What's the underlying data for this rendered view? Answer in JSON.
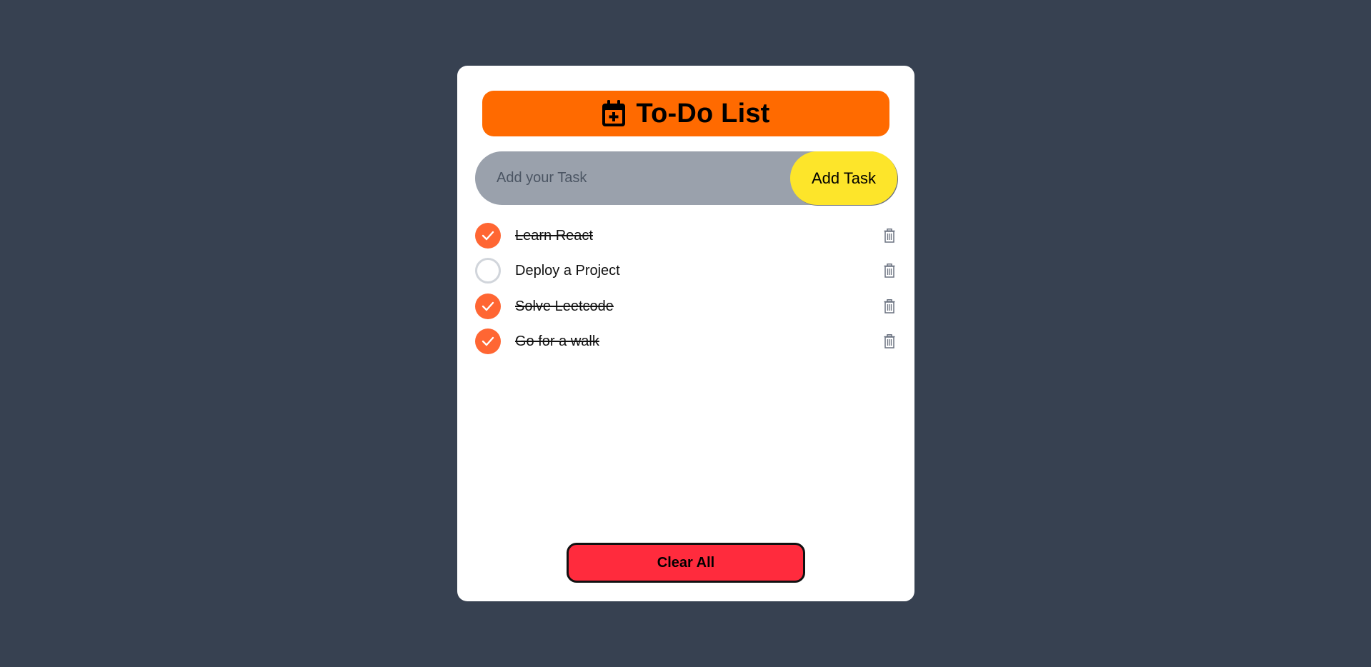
{
  "app": {
    "title": "To-Do List"
  },
  "colors": {
    "background": "#374151",
    "header": "#ff6a00",
    "accent": "#ff6633",
    "add_button": "#fde52a",
    "clear_button": "#ff2b3d"
  },
  "input": {
    "value": "",
    "placeholder": "Add your Task",
    "button_label": "Add Task"
  },
  "tasks": [
    {
      "text": "Learn React",
      "completed": true
    },
    {
      "text": "Deploy a Project",
      "completed": false
    },
    {
      "text": "Solve Leetcode",
      "completed": true
    },
    {
      "text": "Go for a walk",
      "completed": true
    }
  ],
  "icons": {
    "header": "calendar-plus-icon",
    "check": "checkmark-icon",
    "delete": "trash-icon"
  },
  "footer": {
    "clear_label": "Clear All"
  }
}
